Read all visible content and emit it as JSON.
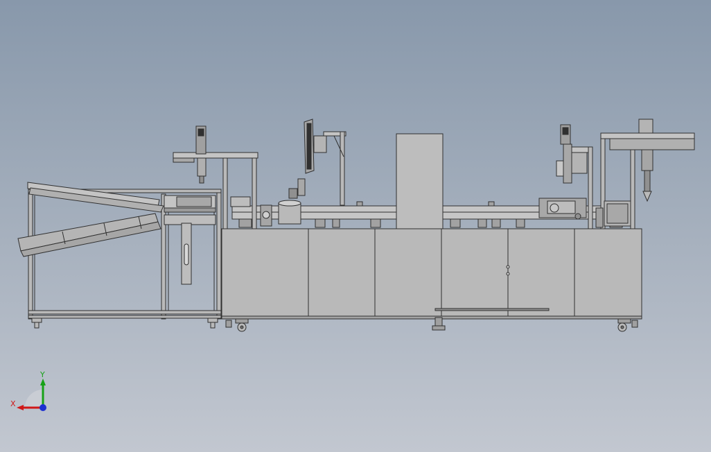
{
  "viewport": {
    "background_top": "#8898ab",
    "background_bottom": "#c2c7d0"
  },
  "colors": {
    "part_fill": "#b9b9b9",
    "part_fill_light": "#c4c4c4",
    "part_fill_dark": "#9a9a9a",
    "edge": "#303030",
    "axis_x": "#d01818",
    "axis_y": "#17a117",
    "axis_z": "#1c2fd0"
  },
  "triad": {
    "x_label": "X",
    "y_label": "Y"
  },
  "icons": {
    "triad": "triad-icon"
  }
}
